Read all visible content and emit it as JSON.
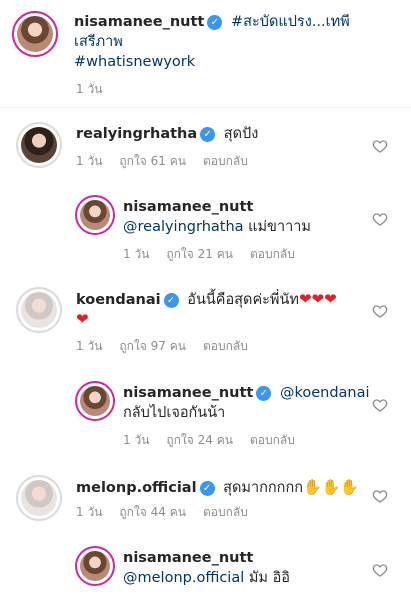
{
  "post": {
    "username": "nisamanee_nutt",
    "caption_line1": "#สะบัดแปรง...เทพี",
    "caption_line2": "เสรีภาพ",
    "hashtag": "#whatisnewyork",
    "time": "1 วัน"
  },
  "comments": [
    {
      "username": "realyingrhatha",
      "text": "สุดปัง",
      "time": "1 วัน",
      "likes": "ถูกใจ 61 คน",
      "reply": "ตอบกลับ"
    },
    {
      "username": "nisamanee_nutt",
      "mention": "@realyingrhatha",
      "text": "แม่ขาาาม",
      "time": "1 วัน",
      "likes": "ถูกใจ 21 คน",
      "reply": "ตอบกลับ"
    },
    {
      "username": "koendanai",
      "text": "อันนี้คือสุดค่ะพี่นัท",
      "time": "1 วัน",
      "likes": "ถูกใจ 97 คน",
      "reply": "ตอบกลับ"
    },
    {
      "username": "nisamanee_nutt",
      "mention": "@koendanai",
      "text": "กลับไปเจอกันน้า",
      "time": "1 วัน",
      "likes": "ถูกใจ 24 คน",
      "reply": "ตอบกลับ"
    },
    {
      "username": "melonp.official",
      "text": "สุดมากกกกก",
      "time": "1 วัน",
      "likes": "ถูกใจ 44 คน",
      "reply": "ตอบกลับ"
    },
    {
      "username": "nisamanee_nutt",
      "mention": "@melonp.official",
      "text": "มัม อิอิ"
    }
  ],
  "icons": {
    "verified": "verified-badge-icon",
    "like": "heart-outline-icon",
    "emoji_heart": "red-heart-emoji",
    "emoji_wave": "waving-hand-emoji"
  },
  "colors": {
    "link": "#00376b",
    "meta": "#8e8e8e",
    "verified": "#3897f0",
    "heart": "#ed1c24"
  }
}
